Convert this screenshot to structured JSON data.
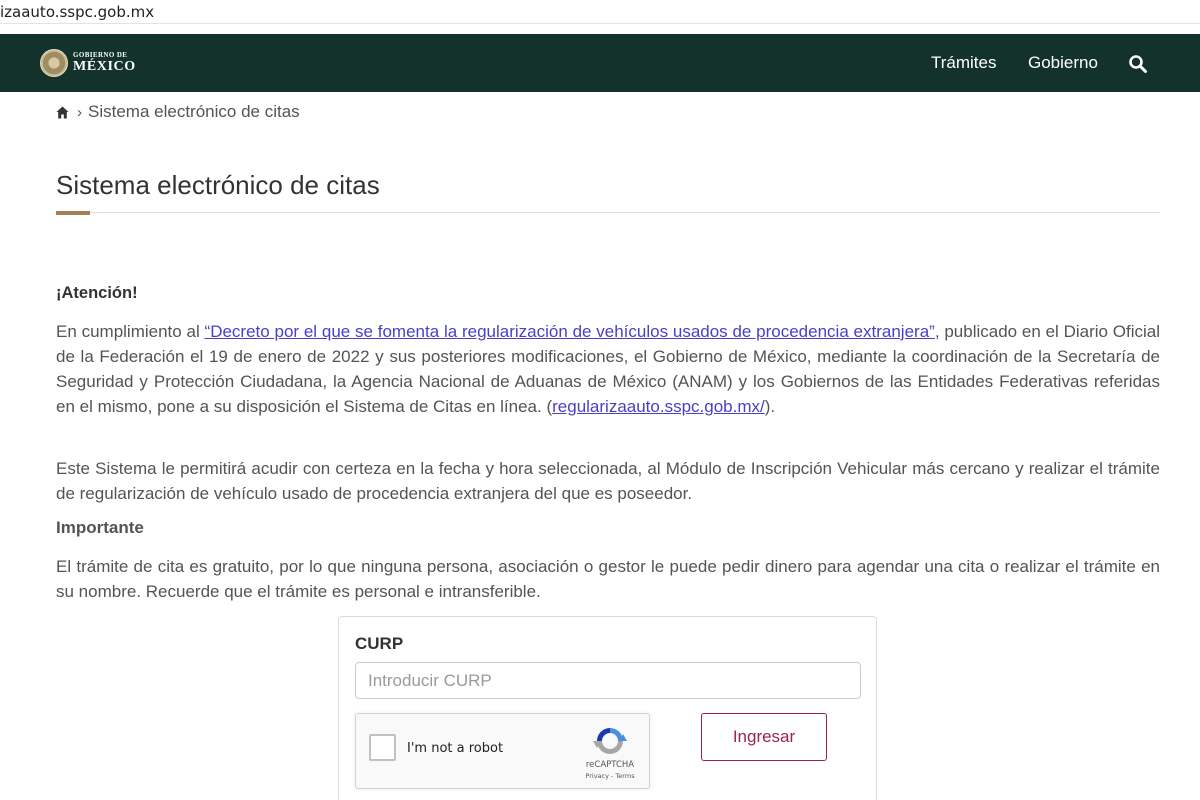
{
  "browser": {
    "url": "izaauto.sspc.gob.mx"
  },
  "header": {
    "logo_line1": "GOBIERNO DE",
    "logo_line2": "MÉXICO",
    "nav": [
      {
        "label": "Trámites"
      },
      {
        "label": "Gobierno"
      }
    ],
    "colors": {
      "background": "#13322b",
      "accent": "#a57f56",
      "button": "#9d2449"
    }
  },
  "breadcrumb": {
    "current": "Sistema electrónico de citas"
  },
  "page": {
    "title": "Sistema electrónico de citas",
    "attention_heading": "¡Atención!",
    "p1_before": "En cumplimiento al ",
    "p1_link": "“Decreto por el que se fomenta la regularización de vehículos usados de procedencia extranjera”",
    "p1_after": ", publicado en el Diario Oficial de la Federación el 19 de enero de 2022 y sus posteriores modificaciones, el Gobierno de México, mediante la coordinación de la Secretaría de Seguridad y Protección Ciudadana, la Agencia Nacional de Aduanas de México (ANAM) y los Gobiernos de las Entidades Federativas referidas en el mismo, pone a su disposición el Sistema de Citas en línea.",
    "p1_link2_open": "(",
    "p1_link2": "regularizaauto.sspc.gob.mx/",
    "p1_link2_close": ").",
    "p2": "Este Sistema le permitirá acudir con certeza en la fecha y hora seleccionada, al Módulo de Inscripción Vehicular más cercano y realizar el trámite de regularización de vehículo usado de procedencia extranjera del que es poseedor.",
    "important_heading": "Importante",
    "p3": "El trámite de cita es gratuito, por lo que ninguna persona, asociación o gestor le puede pedir dinero para agendar una cita o realizar el trámite en su nombre. Recuerde que el trámite es personal e intransferible."
  },
  "form": {
    "curp_label": "CURP",
    "curp_value": "",
    "curp_placeholder": "Introducir CURP",
    "recaptcha_label": "I'm not a robot",
    "recaptcha_brand": "reCAPTCHA",
    "recaptcha_terms": "Privacy - Terms",
    "submit_label": "Ingresar"
  }
}
